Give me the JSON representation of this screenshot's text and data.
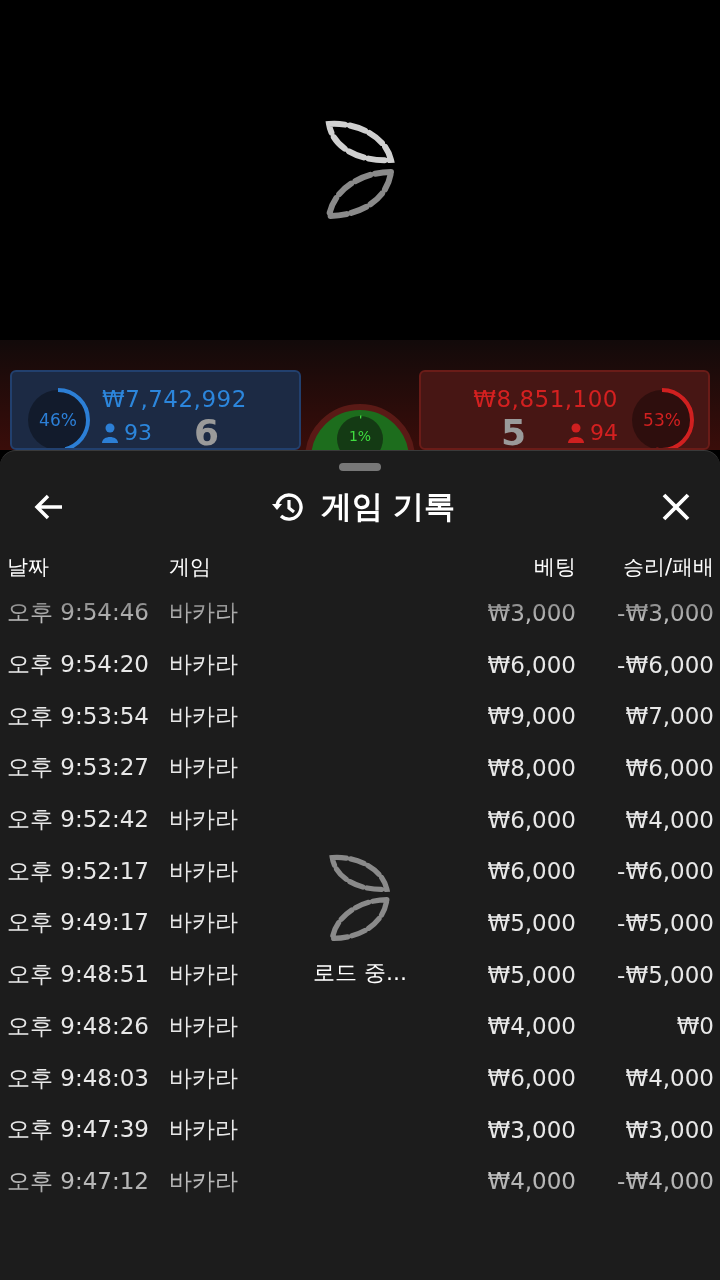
{
  "game_bar": {
    "player": {
      "percent": "46%",
      "level": 0.46,
      "amount": "₩7,742,992",
      "players": "93",
      "score": "6"
    },
    "tie": {
      "percent": "1%",
      "level": 0.01
    },
    "banker": {
      "percent": "53%",
      "level": 0.53,
      "amount": "₩8,851,100",
      "players": "94",
      "score": "5"
    }
  },
  "sheet": {
    "title": "게임 기록",
    "columns": [
      "날짜",
      "게임",
      "베팅",
      "승리/패배"
    ],
    "rows": [
      {
        "date": "오후 9:54:46",
        "game": "바카라",
        "bet": "₩3,000",
        "result": "-₩3,000"
      },
      {
        "date": "오후 9:54:20",
        "game": "바카라",
        "bet": "₩6,000",
        "result": "-₩6,000"
      },
      {
        "date": "오후 9:53:54",
        "game": "바카라",
        "bet": "₩9,000",
        "result": "₩7,000"
      },
      {
        "date": "오후 9:53:27",
        "game": "바카라",
        "bet": "₩8,000",
        "result": "₩6,000"
      },
      {
        "date": "오후 9:52:42",
        "game": "바카라",
        "bet": "₩6,000",
        "result": "₩4,000"
      },
      {
        "date": "오후 9:52:17",
        "game": "바카라",
        "bet": "₩6,000",
        "result": "-₩6,000"
      },
      {
        "date": "오후 9:49:17",
        "game": "바카라",
        "bet": "₩5,000",
        "result": "-₩5,000"
      },
      {
        "date": "오후 9:48:51",
        "game": "바카라",
        "bet": "₩5,000",
        "result": "-₩5,000"
      },
      {
        "date": "오후 9:48:26",
        "game": "바카라",
        "bet": "₩4,000",
        "result": "₩0"
      },
      {
        "date": "오후 9:48:03",
        "game": "바카라",
        "bet": "₩6,000",
        "result": "₩4,000"
      },
      {
        "date": "오후 9:47:39",
        "game": "바카라",
        "bet": "₩3,000",
        "result": "₩3,000"
      },
      {
        "date": "오후 9:47:12",
        "game": "바카라",
        "bet": "₩4,000",
        "result": "-₩4,000"
      }
    ],
    "loading_text": "로드 중..."
  }
}
